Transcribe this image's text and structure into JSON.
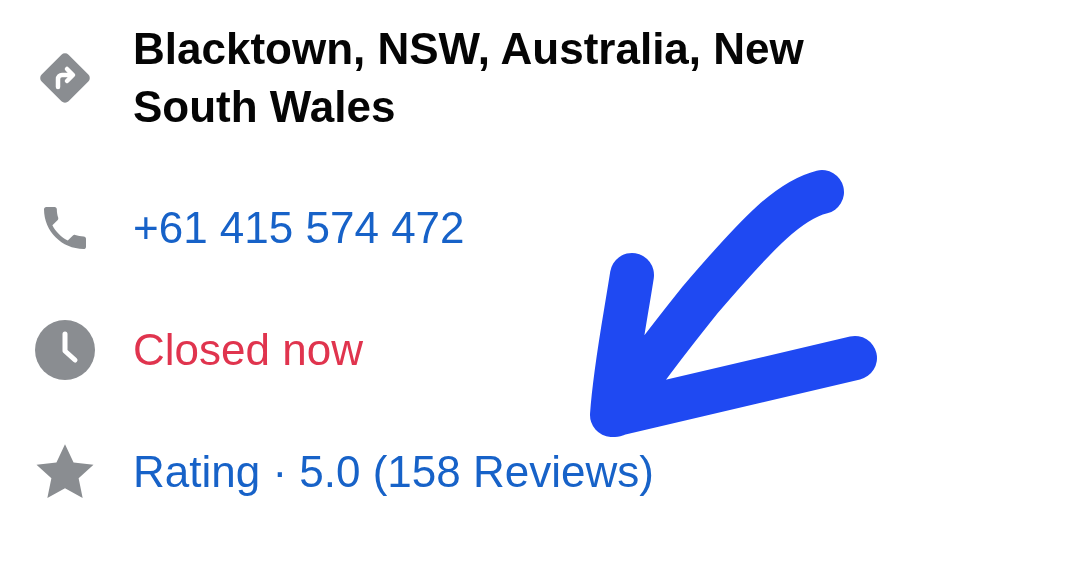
{
  "details": [
    {
      "kind": "address",
      "text": "Blacktown, NSW, Australia, New South Wales"
    },
    {
      "kind": "phone",
      "text": "+61 415 574 472"
    },
    {
      "kind": "hours",
      "text": "Closed now"
    },
    {
      "kind": "rating",
      "text": "Rating · 5.0 (158 Reviews)"
    }
  ],
  "annotation": {
    "kind": "arrow"
  }
}
